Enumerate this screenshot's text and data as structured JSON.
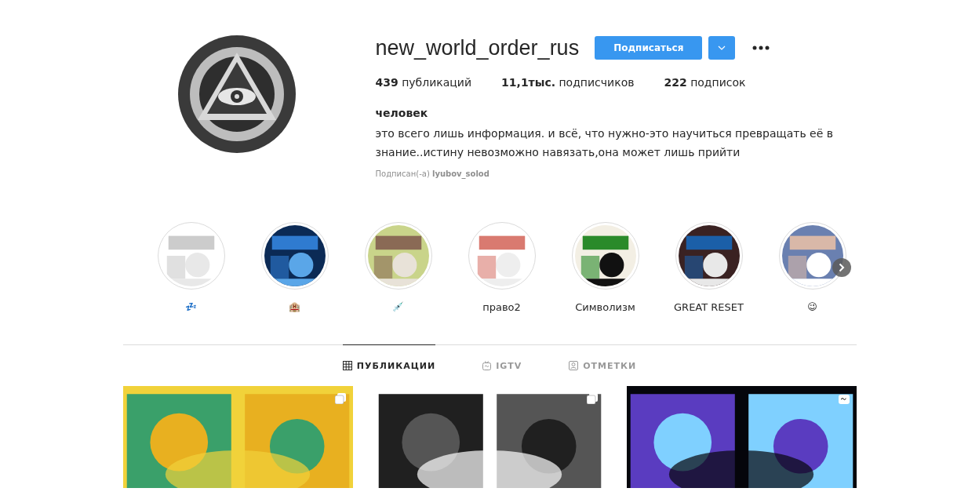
{
  "profile": {
    "username": "new_world_order_rus",
    "follow_button": "Подписаться",
    "stats": [
      "**439** публикаций",
      "**11,1тыс.** подписчиков",
      "**222** подписок"
    ],
    "name": "человек",
    "bio": "это всего лишь информация. и всё, что нужно-это научиться превращать её в знание..истину невозможно навязать,она может лишь прийти",
    "followed_by": "Подписан(-а) **lyubov_solod**"
  },
  "highlights": [
    {
      "label": "💤",
      "kind": "emoji"
    },
    {
      "label": "🏨",
      "kind": "emoji"
    },
    {
      "label": "💉",
      "kind": "emoji"
    },
    {
      "label": "право2",
      "kind": "text"
    },
    {
      "label": "Символизм",
      "kind": "text"
    },
    {
      "label": "GREAT RESET",
      "kind": "text"
    },
    {
      "label": "😉",
      "kind": "emoji"
    }
  ],
  "tabs": [
    {
      "label": "ПУБЛИКАЦИИ",
      "kind": "grid",
      "selected": true
    },
    {
      "label": "IGTV",
      "kind": "tv",
      "selected": false
    },
    {
      "label": "ОТМЕТКИ",
      "kind": "tag",
      "selected": false
    }
  ],
  "posts": [
    {
      "kind": "carousel"
    },
    {
      "kind": "carousel"
    },
    {
      "kind": "igtv"
    }
  ]
}
